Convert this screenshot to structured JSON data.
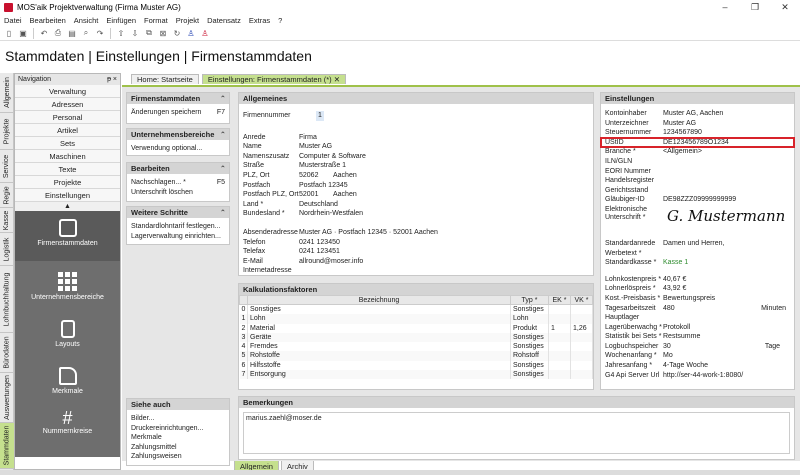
{
  "window": {
    "title": "MOS'aik Projektverwaltung (Firma Muster AG)",
    "controls": [
      "–",
      "❐",
      "✕"
    ]
  },
  "menu": [
    "Datei",
    "Bearbeiten",
    "Ansicht",
    "Einfügen",
    "Format",
    "Projekt",
    "Datensatz",
    "Extras",
    "?"
  ],
  "toolbar_icons": [
    "new-doc-icon",
    "save-icon",
    "undo-icon",
    "print-icon",
    "preview-icon",
    "search-icon",
    "redo-icon",
    "up-icon",
    "down-icon",
    "copy-icon",
    "export-icon",
    "refresh-icon",
    "person-blue-icon",
    "person-red-icon"
  ],
  "page": {
    "heading": "Stammdaten | Einstellungen | Firmenstammdaten"
  },
  "vtabs": [
    "Allgemein",
    "Projekte",
    "Service",
    "Regie",
    "Kasse",
    "Logistik",
    "Lohnbuchhaltung",
    "Bürodaten",
    "Auswertungen",
    "Stammdaten"
  ],
  "nav": {
    "title": "Navigation",
    "pin": "ᵽ ×",
    "items": [
      "Verwaltung",
      "Adressen",
      "Personal",
      "Artikel",
      "Sets",
      "Maschinen",
      "Texte",
      "Projekte",
      "Einstellungen"
    ],
    "dark_items": [
      "Firmenstammdaten",
      "Unternehmensbereiche",
      "Layouts",
      "Merkmale",
      "Nummernkreise"
    ]
  },
  "tabs": {
    "home": "Home: Startseite",
    "current": "Einstellungen: Firmenstammdaten (*)",
    "bottom": [
      "Allgemein",
      "Archiv"
    ]
  },
  "side": {
    "firmen": {
      "title": "Firmenstammdaten",
      "rows": [
        {
          "k": "Änderungen speichern",
          "v": "F7"
        }
      ]
    },
    "unternehmen": {
      "title": "Unternehmensbereiche",
      "rows": [
        {
          "k": "Verwendung optional...",
          "v": ""
        }
      ]
    },
    "bearbeiten": {
      "title": "Bearbeiten",
      "rows": [
        {
          "k": "Nachschlagen... *",
          "v": "F5"
        },
        {
          "k": "Unterschrift löschen",
          "v": ""
        }
      ]
    },
    "weitere": {
      "title": "Weitere Schritte",
      "rows": [
        {
          "k": "Standardlohntarif festlegen...",
          "v": ""
        },
        {
          "k": "Lagerverwaltung einrichten...",
          "v": ""
        }
      ]
    },
    "siehe": {
      "title": "Siehe auch",
      "rows": [
        "Bilder...",
        "Druckereinrichtungen...",
        "Merkmale",
        "Zahlungsmittel",
        "Zahlungsweisen"
      ]
    }
  },
  "allgemein": {
    "title": "Allgemeines",
    "firmennummer_label": "Firmennummer",
    "firmennummer": "1",
    "anrede_l": "Anrede",
    "anrede": "Firma",
    "name_l": "Name",
    "name": "Muster AG",
    "nz_l": "Namenszusatz",
    "nz": "Computer & Software",
    "str_l": "Straße",
    "str": "Musterstraße 1",
    "plz_l": "PLZ, Ort",
    "plz": "52062",
    "ort": "Aachen",
    "pf_l": "Postfach",
    "pf": "Postfach 12345",
    "pfplz_l": "Postfach PLZ, Ort",
    "pfplz": "52001",
    "pfort": "Aachen",
    "land_l": "Land *",
    "land": "Deutschland",
    "bl_l": "Bundesland *",
    "bl": "Nordrhein-Westfalen",
    "abs_l": "Absenderadresse",
    "abs": "Muster AG · Postfach 12345 · 52001 Aachen",
    "tel_l": "Telefon",
    "tel": "0241 123450",
    "fax_l": "Telefax",
    "fax": "0241 123451",
    "mail_l": "E-Mail",
    "mail": "allround@moser.info",
    "web_l": "Internetadresse",
    "web": ""
  },
  "einstellungen": {
    "title": "Einstellungen",
    "rows": [
      {
        "l": "Kontoinhaber",
        "v": "Muster AG, Aachen"
      },
      {
        "l": "Unterzeichner",
        "v": "Muster AG"
      },
      {
        "l": "Steuernummer",
        "v": "1234567890"
      },
      {
        "l": "UStID",
        "v": "DE123456789O1234"
      },
      {
        "l": "Branche *",
        "v": "<Allgemein>"
      },
      {
        "l": "ILN/GLN",
        "v": ""
      },
      {
        "l": "EORI Nummer",
        "v": ""
      },
      {
        "l": "Handelsregister",
        "v": ""
      },
      {
        "l": "Gerichtsstand",
        "v": ""
      },
      {
        "l": "Gläubiger-ID",
        "v": "DE98ZZZ09999999999"
      }
    ],
    "sig_l": "Elektronische Unterschrift *",
    "sig": "G. Mustermann",
    "sa_l": "Standardanrede",
    "sa": "Damen und Herren,",
    "wt_l": "Werbetext *",
    "wt": "",
    "sk_l": "Standardkasse *",
    "sk": "Kasse 1",
    "rows2": [
      {
        "l": "Lohnkostenpreis *",
        "v": "40,67 €",
        "u": ""
      },
      {
        "l": "Lohnerlöspreis *",
        "v": "43,92 €",
        "u": ""
      },
      {
        "l": "Kost.-Preisbasis *",
        "v": "Bewertungspreis",
        "u": ""
      },
      {
        "l": "Tagesarbeitszeit",
        "v": "480",
        "u": "Minuten"
      },
      {
        "l": "Hauptlager",
        "v": "",
        "u": ""
      },
      {
        "l": "Lagerüberwachg *",
        "v": "Protokoll",
        "u": ""
      },
      {
        "l": "Statistik bei Sets *",
        "v": "Restsumme",
        "u": ""
      },
      {
        "l": "Logbuchspeicher",
        "v": "30",
        "u": "Tage"
      },
      {
        "l": "Wochenanfang *",
        "v": "Mo",
        "u": ""
      },
      {
        "l": "Jahresanfang *",
        "v": "4-Tage Woche",
        "u": ""
      },
      {
        "l": "G4 Api Server Url",
        "v": "http://ser-44-work-1:8080/",
        "u": ""
      }
    ]
  },
  "kalk": {
    "title": "Kalkulationsfaktoren",
    "headers": [
      "",
      "Bezeichnung",
      "Typ *",
      "EK *",
      "VK *"
    ],
    "rows": [
      [
        "0",
        "Sonstiges",
        "Sonstiges",
        "",
        ""
      ],
      [
        "1",
        "Lohn",
        "Lohn",
        "",
        ""
      ],
      [
        "2",
        "Material",
        "Produkt",
        "1",
        "1,26"
      ],
      [
        "3",
        "Geräte",
        "Sonstiges",
        "",
        ""
      ],
      [
        "4",
        "Fremdes",
        "Sonstiges",
        "",
        ""
      ],
      [
        "5",
        "Rohstoffe",
        "Rohstoff",
        "",
        ""
      ],
      [
        "6",
        "Hilfsstoffe",
        "Sonstiges",
        "",
        ""
      ],
      [
        "7",
        "Entsorgung",
        "Sonstiges",
        "",
        ""
      ]
    ]
  },
  "bemerk": {
    "title": "Bemerkungen",
    "text": "marius.zaehl@moser.de"
  },
  "colors": {
    "accent": "#c5e08e",
    "highlight": "#d8232a",
    "dark_nav": "#6e6e6e"
  }
}
